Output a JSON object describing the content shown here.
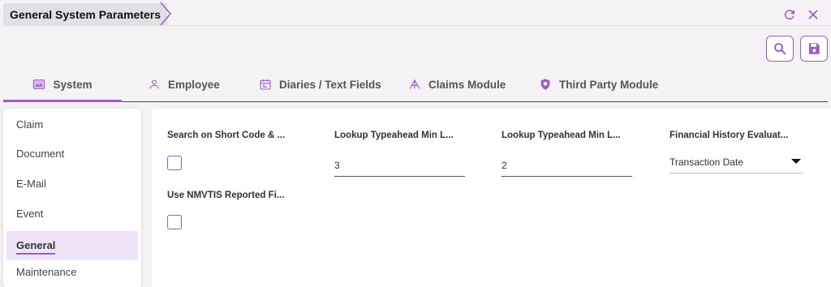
{
  "breadcrumb": {
    "title": "General System Parameters"
  },
  "header": {
    "refresh_icon": "refresh-icon",
    "close_icon": "close-icon"
  },
  "toolbar": {
    "search_icon": "search-icon",
    "save_icon": "save-icon"
  },
  "accent": "#9c5ec4",
  "tabs": [
    {
      "label": "System",
      "icon": "system-icon",
      "active": true
    },
    {
      "label": "Employee",
      "icon": "person-icon",
      "active": false
    },
    {
      "label": "Diaries / Text Fields",
      "icon": "calendar-icon",
      "active": false
    },
    {
      "label": "Claims Module",
      "icon": "claims-icon",
      "active": false
    },
    {
      "label": "Third Party Module",
      "icon": "shield-icon",
      "active": false
    }
  ],
  "sidenav": {
    "items": [
      {
        "label": "Claim"
      },
      {
        "label": "Document"
      },
      {
        "label": "E-Mail"
      },
      {
        "label": "Event"
      },
      {
        "label": "General",
        "active": true
      },
      {
        "label": "Maintenance"
      }
    ]
  },
  "fields": {
    "search_short_code": {
      "label": "Search on Short Code & ...",
      "checked": false
    },
    "lookup_min_1": {
      "label": "Lookup Typeahead Min L...",
      "value": "3"
    },
    "lookup_min_2": {
      "label": "Lookup Typeahead Min L...",
      "value": "2"
    },
    "financial_history": {
      "label": "Financial History Evaluat...",
      "value": "Transaction Date"
    },
    "use_nmvtis": {
      "label": "Use NMVTIS Reported Fi...",
      "checked": false
    }
  }
}
